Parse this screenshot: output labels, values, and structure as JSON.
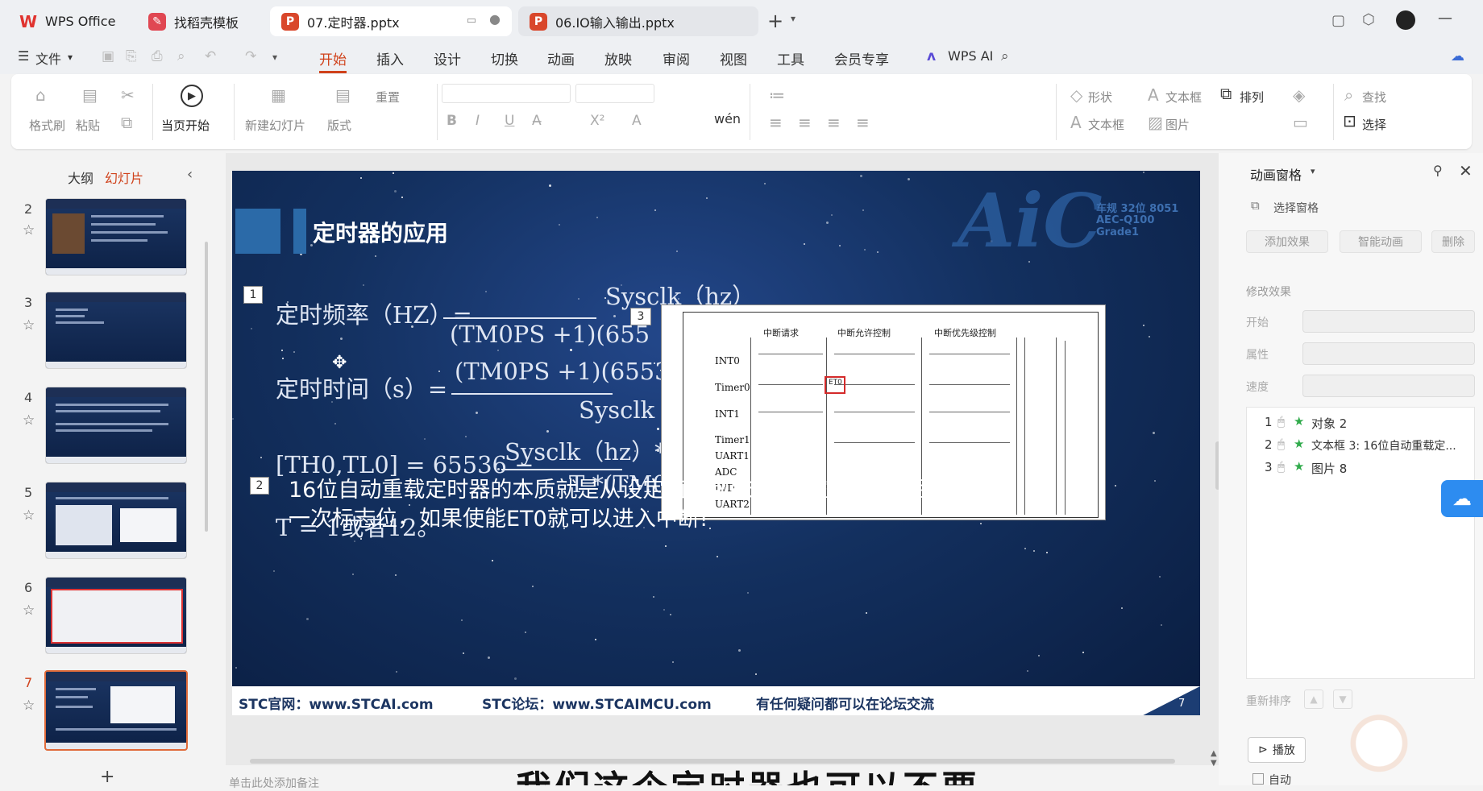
{
  "app": {
    "name": "WPS Office"
  },
  "tabs": [
    {
      "label": "WPS Office"
    },
    {
      "label": "找稻壳模板"
    },
    {
      "label": "07.定时器.pptx"
    },
    {
      "label": "06.IO输入输出.pptx"
    }
  ],
  "menu": {
    "file": "文件",
    "items": [
      "开始",
      "插入",
      "设计",
      "切换",
      "动画",
      "放映",
      "审阅",
      "视图",
      "工具",
      "会员专享"
    ],
    "ai": "WPS AI"
  },
  "ribbon": {
    "format_painter": "格式刷",
    "paste": "粘贴",
    "from_current": "当页开始",
    "new_slide": "新建幻灯片",
    "layout": "版式",
    "reset": "重置",
    "shape": "形状",
    "textbox": "文本框",
    "arrange": "排列",
    "find": "查找",
    "textbox2": "文本框",
    "picture": "图片",
    "select": "选择"
  },
  "leftpane": {
    "outline": "大纲",
    "slides": "幻灯片",
    "numbers": [
      "2",
      "3",
      "4",
      "5",
      "6",
      "7"
    ]
  },
  "slide": {
    "title": "定时器的应用",
    "badge1": "1",
    "badge2": "2",
    "badge3": "3",
    "f1_lhs": "定时频率（HZ）=",
    "f1_num": "Sysclk（hz）",
    "f1_den": "(TM0PS +1)(655",
    "f2_lhs": "定时时间（s）=",
    "f2_num": "(TM0PS +1)(65536",
    "f2_den": "Sysclk",
    "f3_lhs": "[TH0,TL0] = 65536 −",
    "f3_num": "Sysclk（hz）* 定",
    "f3_den": "T *(TM0",
    "f4": "T = 1或者12。",
    "p2_line1": "16位自动重载定时器的本质就是从设定值数到65536（溢出）之后置位",
    "p2_line2": "一次标志位，如果使能ET0就可以进入中断!",
    "logo": "AiC",
    "logo_sub1": "车规 32位 8051",
    "logo_sub2": "AEC-Q100 Grade1",
    "footer": {
      "site": "STC官网：www.STCAI.com",
      "forum": "STC论坛：www.STCAIMCU.com",
      "help": "有任何疑问都可以在论坛交流",
      "page": "7"
    },
    "diagram": {
      "col1": "中断请求",
      "col2": "中断允许控制",
      "col3": "中断优先级控制",
      "rows": [
        "INT0",
        "Timer0",
        "INT1",
        "Timer1",
        "UART1",
        "ADC",
        "LVD",
        "UART2"
      ],
      "et0": "ET0"
    }
  },
  "rightpane": {
    "title": "动画窗格",
    "select_pane": "选择窗格",
    "add_effect": "添加效果",
    "smart_anim": "智能动画",
    "delete": "删除",
    "modify": "修改效果",
    "start": "开始",
    "property": "属性",
    "speed": "速度",
    "items": [
      {
        "num": "1",
        "label": "对象 2"
      },
      {
        "num": "2",
        "label": "文本框 3: 16位自动重载定..."
      },
      {
        "num": "3",
        "label": "图片 8"
      }
    ],
    "reorder": "重新排序",
    "play": "播放",
    "auto": "自动"
  },
  "bottom": {
    "notes": "单击此处添加备注",
    "subtitle": "我们这个定时器也可以不要"
  }
}
